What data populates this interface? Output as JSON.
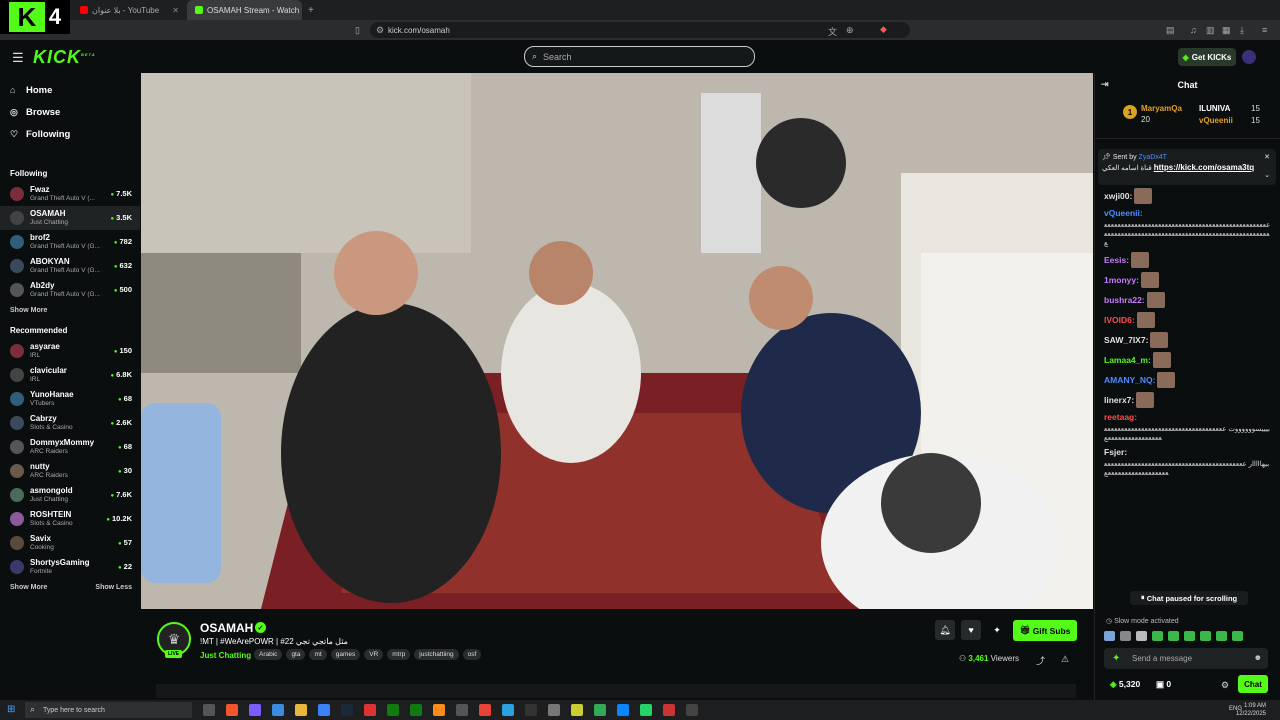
{
  "browser": {
    "overlay_badge": "4",
    "tabs": [
      {
        "label": "بلا عنوان - YouTube",
        "active": false
      },
      {
        "label": "OSAMAH Stream - Watch Live",
        "active": true
      }
    ],
    "url": "kick.com/osamah"
  },
  "header": {
    "logo": "KICK",
    "logo_sup": "BETA",
    "search_placeholder": "Search",
    "get_kicks": "Get KICKs"
  },
  "sidebar": {
    "nav": [
      {
        "label": "Home",
        "icon": "home-icon"
      },
      {
        "label": "Browse",
        "icon": "browse-icon"
      },
      {
        "label": "Following",
        "icon": "heart-icon"
      }
    ],
    "following_title": "Following",
    "following": [
      {
        "name": "Fwaz",
        "category": "Grand Theft Auto V (...",
        "viewers": "7.5K"
      },
      {
        "name": "OSAMAH",
        "category": "Just Chatting",
        "viewers": "3.5K"
      },
      {
        "name": "brof2",
        "category": "Grand Theft Auto V (G...",
        "viewers": "782"
      },
      {
        "name": "ABOKYAN",
        "category": "Grand Theft Auto V (G...",
        "viewers": "632"
      },
      {
        "name": "Ab2dy",
        "category": "Grand Theft Auto V (G...",
        "viewers": "500"
      }
    ],
    "show_more": "Show More",
    "recommended_title": "Recommended",
    "recommended": [
      {
        "name": "asyarae",
        "category": "IRL",
        "viewers": "150"
      },
      {
        "name": "clavicular",
        "category": "IRL",
        "viewers": "6.8K"
      },
      {
        "name": "YunoHanae",
        "category": "VTubers",
        "viewers": "68"
      },
      {
        "name": "Cabrzy",
        "category": "Slots & Casino",
        "viewers": "2.6K"
      },
      {
        "name": "DommyxMommy",
        "category": "ARC Raiders",
        "viewers": "68"
      },
      {
        "name": "nutty",
        "category": "ARC Raiders",
        "viewers": "30"
      },
      {
        "name": "asmongold",
        "category": "Just Chatting",
        "viewers": "7.6K"
      },
      {
        "name": "ROSHTEIN",
        "category": "Slots & Casino",
        "viewers": "10.2K"
      },
      {
        "name": "Savix",
        "category": "Cooking",
        "viewers": "57"
      },
      {
        "name": "ShortysGaming",
        "category": "Fortnite",
        "viewers": "22"
      }
    ],
    "show_more_2": "Show More",
    "show_less": "Show Less"
  },
  "stream": {
    "live": "LIVE",
    "channel": "OSAMAH",
    "title": "!MT | #WeArePOWR | #22 مثل ماتجي تجي",
    "category": "Just Chatting",
    "tags": [
      "Arabic",
      "gta",
      "mt",
      "games",
      "VR",
      "mtrp",
      "justchattiing",
      "osf"
    ],
    "gift_subs": "Gift Subs",
    "viewers": "3,461",
    "viewers_label": "Viewers"
  },
  "chat": {
    "title": "Chat",
    "leaderboard": [
      {
        "rank": "1",
        "name": "MaryamQa",
        "count": "20"
      },
      {
        "name": "ILUNIVA",
        "count": "15"
      },
      {
        "name": "vQueenii",
        "count": "15"
      }
    ],
    "pinned": {
      "sent_by": "Sent by",
      "user": "ZyaDx4T",
      "text": "قناة اسامه العكي",
      "link": "https://kick.com/osama3tq"
    },
    "messages": [
      {
        "user": "xwji00:",
        "color": "#e0e0e0",
        "body": ""
      },
      {
        "user": "vQueenii:",
        "color": "#4b8cff",
        "body": "ععععععععععععععععععععععععععععععععععععععععععععععععععععععععععععععععععععععععععععععععععععععععععععععععععع"
      },
      {
        "user": "Eesis:",
        "color": "#c77dff",
        "body": ""
      },
      {
        "user": "1monyy:",
        "color": "#c77dff",
        "body": ""
      },
      {
        "user": "bushra22:",
        "color": "#c77dff",
        "body": ""
      },
      {
        "user": "lVOID6:",
        "color": "#ff4d4d",
        "body": ""
      },
      {
        "user": "SAW_7IX7:",
        "color": "#e0e0e0",
        "body": ""
      },
      {
        "user": "Lamaa4_m:",
        "color": "#53fc18",
        "body": ""
      },
      {
        "user": "AMANY_NQ:",
        "color": "#4b8cff",
        "body": ""
      },
      {
        "user": "linerx7:",
        "color": "#e0e0e0",
        "body": ""
      },
      {
        "user": "reetaag:",
        "color": "#ff4d4d",
        "body": "بيييسووووووت ععععععععععععععععععععععععععععععععععععععععععععععععععععع"
      },
      {
        "user": "Fsjer:",
        "color": "#e0e0e0",
        "body": "بيهااااار ععععععععععععععععععععععععععععععععععععععععععععععععععععععععععععع"
      }
    ],
    "paused": "Chat paused for scrolling",
    "slow_mode": "Slow mode activated",
    "send_placeholder": "Send a message",
    "kicks": "5,320",
    "subs": "0",
    "chat_button": "Chat"
  },
  "taskbar": {
    "search_placeholder": "Type here to search",
    "lang": "ENG",
    "time": "1:09 AM",
    "date": "12/22/2025"
  }
}
